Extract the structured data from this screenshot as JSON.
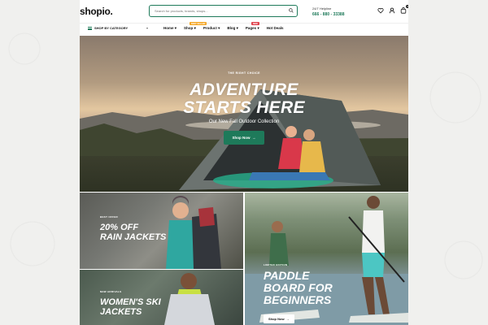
{
  "header": {
    "logo": "shopio.",
    "search_placeholder": "Search for products, brands, shops...",
    "helpline_label": "24/7 Helpline",
    "helpline_number": "666 - 880 - 33388",
    "cart_count": "0"
  },
  "nav": {
    "category_label": "SHOP BY CATEGORY",
    "menu": [
      {
        "label": "Home",
        "caret": "▾"
      },
      {
        "label": "Shop",
        "caret": "▾",
        "tag": "BEST SELLER",
        "tag_color": "#f5a623"
      },
      {
        "label": "Product",
        "caret": "▾"
      },
      {
        "label": "Blog",
        "caret": "▾"
      },
      {
        "label": "Pages",
        "caret": "▾",
        "tag": "NEW",
        "tag_color": "#e0424d"
      },
      {
        "label": "Hot Deals"
      }
    ]
  },
  "hero": {
    "kicker": "THE RIGHT CHOICE",
    "title_line1": "ADVENTURE",
    "title_line2": "STARTS HERE",
    "subtitle": "Our New Fall Outdoor Collection",
    "button": "Shop Now"
  },
  "tiles": [
    {
      "kicker": "BEST OFFER",
      "title_line1": "20% OFF",
      "title_line2": "RAIN JACKETS"
    },
    {
      "kicker": "LIMITED EDITION",
      "title_line1": "PADDLE",
      "title_line2": "BOARD FOR",
      "title_line3": "BEGINNERS",
      "button": "Shop Now"
    },
    {
      "kicker": "NEW ARRIVALS",
      "title_line1": "WOMEN'S SKI",
      "title_line2": "JACKETS"
    }
  ],
  "colors": {
    "brand": "#1e7a5a",
    "tag_orange": "#f5a623",
    "tag_red": "#e0424d"
  },
  "icons": [
    "search-icon",
    "heart-icon",
    "user-icon",
    "cart-icon",
    "menu-icon",
    "arrow-right-icon"
  ]
}
